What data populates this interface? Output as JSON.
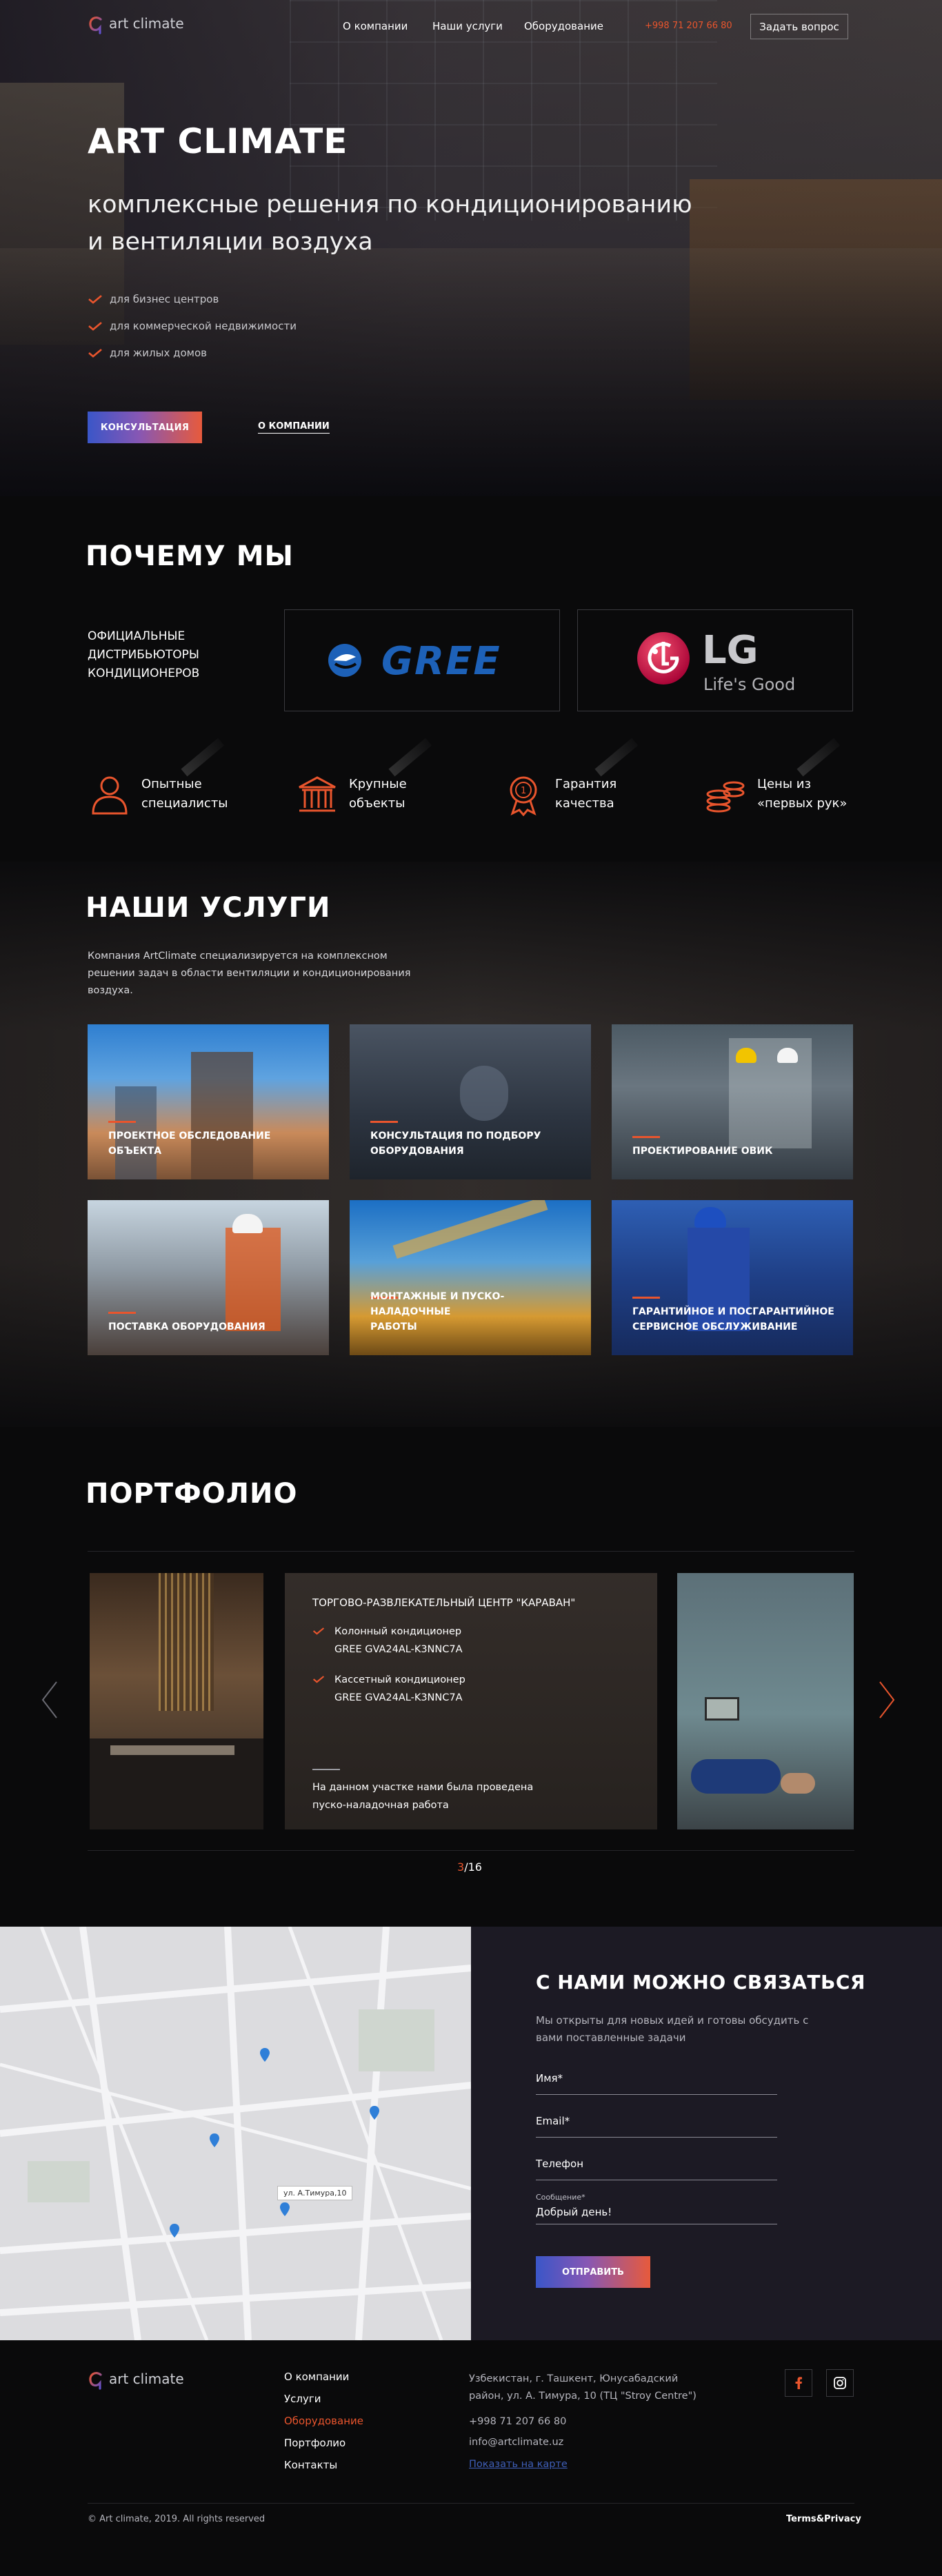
{
  "header": {
    "logo_text": "art climate",
    "nav": [
      "О компании",
      "Наши услуги",
      "Оборудование"
    ],
    "phone": "+998 71 207 66 80",
    "ask_button": "Задать вопрос"
  },
  "hero": {
    "title": "ART CLIMATE",
    "subtitle_line1": "комплексные решения по кондиционированию",
    "subtitle_line2": "и вентиляции воздуха",
    "bullets": [
      "для бизнес центров",
      "для коммерческой недвижимости",
      "для жилых домов"
    ],
    "consult_button": "КОНСУЛЬТАЦИЯ",
    "about_link": "О КОМПАНИИ"
  },
  "why": {
    "title": "ПОЧЕМУ МЫ",
    "distributors": "ОФИЦИАЛЬНЫЕ ДИСТРИБЬЮТОРЫ КОНДИЦИОНЕРОВ",
    "brand1": "GREE",
    "brand2_name": "LG",
    "brand2_slogan": "Life's Good",
    "features": [
      {
        "l1": "Опытные",
        "l2": "специалисты",
        "icon": "specialist-icon"
      },
      {
        "l1": "Крупные",
        "l2": "объекты",
        "icon": "building-icon"
      },
      {
        "l1": "Гарантия",
        "l2": "качества",
        "icon": "medal-icon"
      },
      {
        "l1": "Цены из",
        "l2": "«первых рук»",
        "icon": "coins-icon"
      }
    ]
  },
  "services": {
    "title": "НАШИ УСЛУГИ",
    "description": "Компания ArtClimate специализируется  на комплексном решении задач в области вентиляции и кондиционирования воздуха.",
    "cards": [
      {
        "l1": "ПРОЕКТНОЕ ОБСЛЕДОВАНИЕ",
        "l2": "ОБЪЕКТА"
      },
      {
        "l1": "КОНСУЛЬТАЦИЯ ПО ПОДБОРУ",
        "l2": "ОБОРУДОВАНИЯ"
      },
      {
        "l1": "ПРОЕКТИРОВАНИЕ ОВИК",
        "l2": ""
      },
      {
        "l1": "ПОСТАВКА ОБОРУДОВАНИЯ",
        "l2": ""
      },
      {
        "l1": "МОНТАЖНЫЕ И ПУСКО-НАЛАДОЧНЫЕ",
        "l2": "РАБОТЫ"
      },
      {
        "l1": "ГАРАНТИЙНОЕ И ПОСГАРАНТИЙНОЕ",
        "l2": "СЕРВИСНОЕ ОБСЛУЖИВАНИЕ"
      }
    ]
  },
  "portfolio": {
    "title": "ПОРТФОЛИО",
    "card_title": "ТОРГОВО-РАЗВЛЕКАТЕЛЬНЫЙ ЦЕНТР \"КАРАВАН\"",
    "items": [
      {
        "l1": "Колонный кондиционер",
        "l2": "GREE GVA24AL-K3NNC7A"
      },
      {
        "l1": "Кассетный кондиционер",
        "l2": "GREE GVA24AL-K3NNC7A"
      }
    ],
    "note_l1": "На данном участке нами была проведена",
    "note_l2": "пуско-наладочная работа",
    "pager_current": "3",
    "pager_total": "/16"
  },
  "contact": {
    "title": "С НАМИ МОЖНО СВЯЗАТЬСЯ",
    "text_l1": "Мы открыты для новых идей и готовы обсудить с",
    "text_l2": "вами поставленные задачи",
    "name_label": "Имя*",
    "email_label": "Email*",
    "phone_label": "Телефон",
    "message_caption": "Сообщение*",
    "message_value": "Добрый день!",
    "send_button": "ОТПРАВИТЬ",
    "map_pin_label": "ул. А.Тимура,10"
  },
  "footer": {
    "logo_text": "art climate",
    "links": [
      "О компании",
      "Услуги",
      "Оборудование",
      "Портфолио",
      "Контакты"
    ],
    "address_l1": "Узбекистан, г. Ташкент, Юнусабадский",
    "address_l2": "район, ул. А. Тимура, 10 (ТЦ \"Stroy Centre\")",
    "phone": "+998 71 207 66 80",
    "email": "info@artclimate.uz",
    "map_link": "Показать на карте",
    "copyright": "© Art climate, 2019. All rights reserved",
    "terms": "Terms&Privacy"
  },
  "colors": {
    "accent": "#e9552d",
    "bg": "#0a0a0b",
    "form_bg": "#1c1a24"
  }
}
